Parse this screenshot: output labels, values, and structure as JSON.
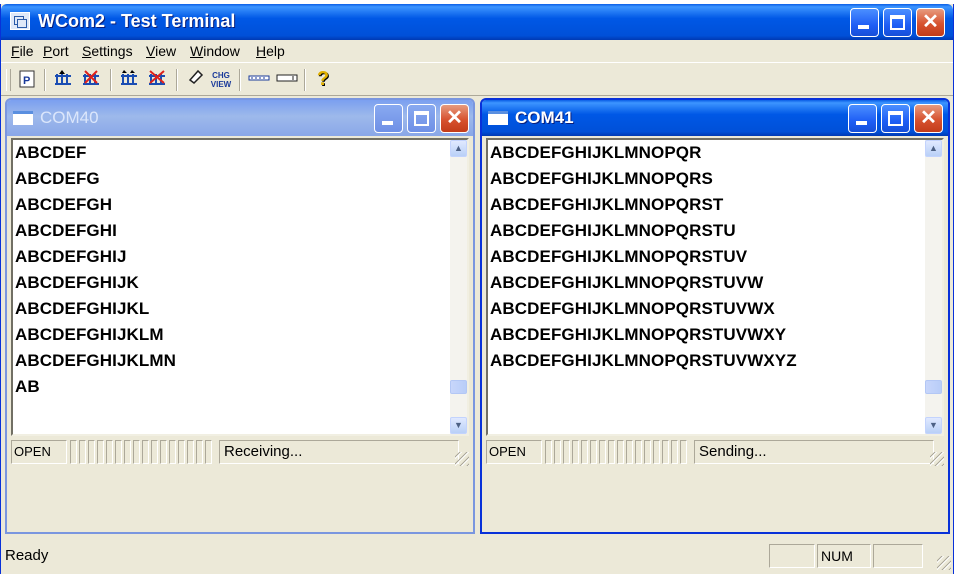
{
  "window": {
    "title": "WCom2 - Test Terminal"
  },
  "menu": [
    {
      "label": "File",
      "mnemonic": "F",
      "rest": "ile"
    },
    {
      "label": "Port",
      "mnemonic": "P",
      "rest": "ort"
    },
    {
      "label": "Settings",
      "mnemonic": "S",
      "rest": "ettings"
    },
    {
      "label": "View",
      "mnemonic": "V",
      "rest": "iew"
    },
    {
      "label": "Window",
      "mnemonic": "W",
      "rest": "indow"
    },
    {
      "label": "Help",
      "mnemonic": "H",
      "rest": "elp"
    }
  ],
  "toolbar": {
    "icons": [
      "properties-icon",
      "connect-icon",
      "disconnect-icon",
      "connect-all-icon",
      "disconnect-all-icon",
      "clear-icon",
      "change-view-icon",
      "hex-view-icon",
      "text-view-icon",
      "help-icon"
    ],
    "chg_view_label": "CHG VIEW"
  },
  "windows": [
    {
      "title": "COM40",
      "lines": [
        "ABCDEF",
        "ABCDEFG",
        "ABCDEFGH",
        "ABCDEFGHI",
        "ABCDEFGHIJ",
        "ABCDEFGHIJK",
        "ABCDEFGHIJKL",
        "ABCDEFGHIJKLM",
        "ABCDEFGHIJKLMN",
        "AB"
      ],
      "status_open": "OPEN",
      "status_text": "Receiving..."
    },
    {
      "title": "COM41",
      "lines": [
        "ABCDEFGHIJKLMNOPQR",
        "ABCDEFGHIJKLMNOPQRS",
        "ABCDEFGHIJKLMNOPQRST",
        "ABCDEFGHIJKLMNOPQRSTU",
        "ABCDEFGHIJKLMNOPQRSTUV",
        "ABCDEFGHIJKLMNOPQRSTUVW",
        "ABCDEFGHIJKLMNOPQRSTUVWX",
        "ABCDEFGHIJKLMNOPQRSTUVWXY",
        "ABCDEFGHIJKLMNOPQRSTUVWXYZ"
      ],
      "status_open": "OPEN",
      "status_text": "Sending..."
    }
  ],
  "statusbar": {
    "ready": "Ready",
    "num": "NUM"
  },
  "colors": {
    "titlebar": "#0058e6",
    "close": "#d7522f",
    "face": "#ece9d8"
  }
}
